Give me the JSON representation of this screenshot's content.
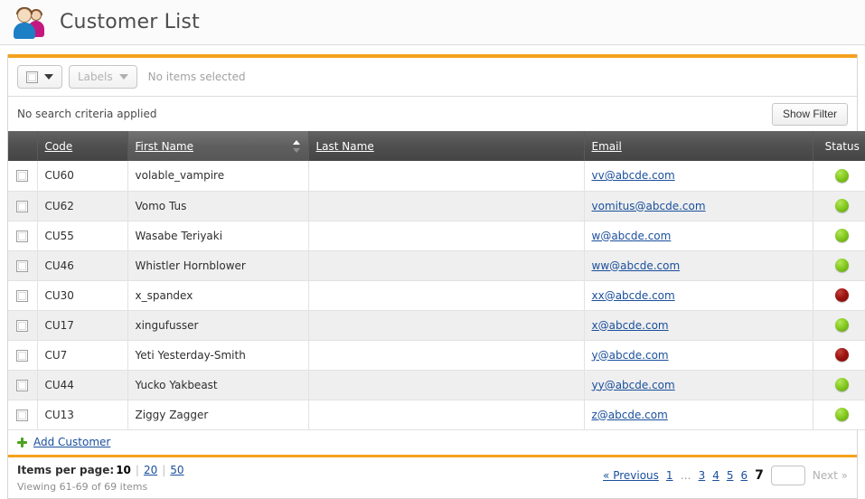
{
  "header": {
    "title": "Customer List",
    "icon": "customers-icon"
  },
  "toolbar": {
    "select_all_icon": "checkbox-unchecked-icon",
    "labels_button": "Labels",
    "selection_status": "No items selected"
  },
  "filter_bar": {
    "criteria_text": "No search criteria applied",
    "show_filter_button": "Show Filter"
  },
  "grid": {
    "columns": [
      {
        "key": "check",
        "label": "",
        "sortable": false,
        "sorted": false
      },
      {
        "key": "code",
        "label": "Code",
        "sortable": true,
        "sorted": false
      },
      {
        "key": "first",
        "label": "First Name",
        "sortable": true,
        "sorted": true,
        "sort_direction": "asc"
      },
      {
        "key": "last",
        "label": "Last Name",
        "sortable": true,
        "sorted": false
      },
      {
        "key": "email",
        "label": "Email",
        "sortable": true,
        "sorted": false
      },
      {
        "key": "status",
        "label": "Status",
        "sortable": false,
        "sorted": false
      }
    ],
    "rows": [
      {
        "code": "CU60",
        "first_name": "volable_vampire",
        "last_name": "",
        "email": "vv@abcde.com",
        "status": "green"
      },
      {
        "code": "CU62",
        "first_name": "Vomo Tus",
        "last_name": "",
        "email": "vomitus@abcde.com",
        "status": "green"
      },
      {
        "code": "CU55",
        "first_name": "Wasabe Teriyaki",
        "last_name": "",
        "email": "w@abcde.com",
        "status": "green"
      },
      {
        "code": "CU46",
        "first_name": "Whistler Hornblower",
        "last_name": "",
        "email": "ww@abcde.com",
        "status": "green"
      },
      {
        "code": "CU30",
        "first_name": "x_spandex",
        "last_name": "",
        "email": "xx@abcde.com",
        "status": "red"
      },
      {
        "code": "CU17",
        "first_name": "xingufusser",
        "last_name": "",
        "email": "x@abcde.com",
        "status": "green"
      },
      {
        "code": "CU7",
        "first_name": "Yeti Yesterday-Smith",
        "last_name": "",
        "email": "y@abcde.com",
        "status": "red"
      },
      {
        "code": "CU44",
        "first_name": "Yucko Yakbeast",
        "last_name": "",
        "email": "yy@abcde.com",
        "status": "green"
      },
      {
        "code": "CU13",
        "first_name": "Ziggy Zagger",
        "last_name": "",
        "email": "z@abcde.com",
        "status": "green"
      }
    ]
  },
  "add_row": {
    "icon": "plus-icon",
    "label": "Add Customer"
  },
  "footer": {
    "items_per_page_label": "Items per page:",
    "items_per_page_current": "10",
    "items_per_page_options": [
      "20",
      "50"
    ],
    "viewing_text": "Viewing 61-69 of 69 items",
    "pager": {
      "previous_label": "« Previous",
      "pages": [
        "1",
        "…",
        "3",
        "4",
        "5",
        "6"
      ],
      "current_page": "7",
      "page_input_value": "",
      "next_label": "Next »",
      "next_disabled": true
    }
  },
  "colors": {
    "accent_orange": "#f5a11e",
    "link_blue": "#1a4f9c",
    "status_green": "#86cc22",
    "status_red": "#9d1510",
    "header_dark": "#4f4f4f"
  }
}
